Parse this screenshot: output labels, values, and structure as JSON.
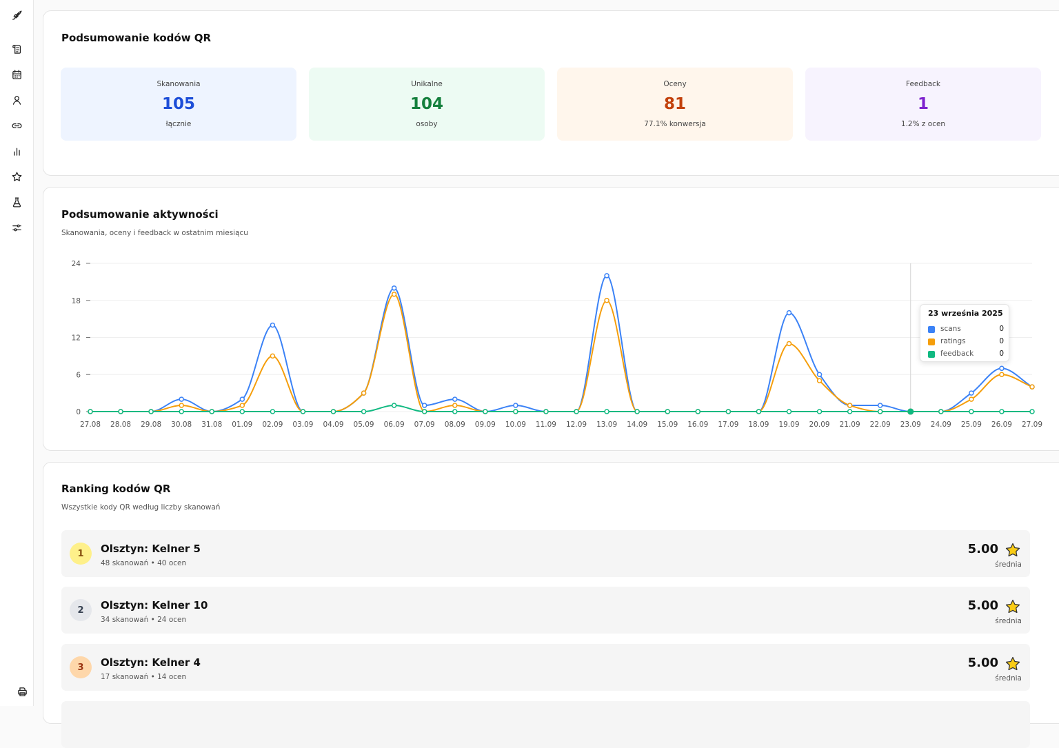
{
  "sidebar": {
    "icons": [
      "rocket-icon",
      "receipt-icon",
      "calendar-icon",
      "user-icon",
      "link-icon",
      "bar-chart-icon",
      "star-icon",
      "flask-icon",
      "settings-sliders-icon",
      "printer-icon"
    ]
  },
  "summary": {
    "title": "Podsumowanie kodów QR",
    "stats": [
      {
        "label": "Skanowania",
        "value": "105",
        "sub": "łącznie",
        "color": "#1d4ed8",
        "bg": "#eef4ff"
      },
      {
        "label": "Unikalne",
        "value": "104",
        "sub": "osoby",
        "color": "#15803d",
        "bg": "#edfbf3"
      },
      {
        "label": "Oceny",
        "value": "81",
        "sub": "77.1% konwersja",
        "color": "#c2410c",
        "bg": "#fff6ec"
      },
      {
        "label": "Feedback",
        "value": "1",
        "sub": "1.2% z ocen",
        "color": "#7e22ce",
        "bg": "#f7f3fe"
      }
    ]
  },
  "activity": {
    "title": "Podsumowanie aktywności",
    "subtitle": "Skanowania, oceny i feedback w ostatnim miesiącu",
    "tooltip": {
      "title": "23 września 2025",
      "rows": [
        {
          "name": "scans",
          "value": "0",
          "color": "#3b82f6"
        },
        {
          "name": "ratings",
          "value": "0",
          "color": "#f59e0b"
        },
        {
          "name": "feedback",
          "value": "0",
          "color": "#10b981"
        }
      ]
    }
  },
  "chart_data": {
    "type": "line",
    "title": "",
    "xlabel": "",
    "ylabel": "",
    "ylim": [
      0,
      24
    ],
    "yticks": [
      0,
      6,
      12,
      18,
      24
    ],
    "grid": true,
    "x": [
      "27.08",
      "28.08",
      "29.08",
      "30.08",
      "31.08",
      "01.09",
      "02.09",
      "03.09",
      "04.09",
      "05.09",
      "06.09",
      "07.09",
      "08.09",
      "09.09",
      "10.09",
      "11.09",
      "12.09",
      "13.09",
      "14.09",
      "15.09",
      "16.09",
      "17.09",
      "18.09",
      "19.09",
      "20.09",
      "21.09",
      "22.09",
      "23.09",
      "24.09",
      "25.09",
      "26.09",
      "27.09"
    ],
    "series": [
      {
        "name": "scans",
        "color": "#3b82f6",
        "values": [
          0,
          0,
          0,
          2,
          0,
          2,
          14,
          0,
          0,
          3,
          20,
          1,
          2,
          0,
          1,
          0,
          0,
          22,
          0,
          0,
          0,
          0,
          0,
          16,
          6,
          1,
          1,
          0,
          0,
          3,
          7,
          4
        ]
      },
      {
        "name": "ratings",
        "color": "#f59e0b",
        "values": [
          0,
          0,
          0,
          1,
          0,
          1,
          9,
          0,
          0,
          3,
          19,
          0,
          1,
          0,
          0,
          0,
          0,
          18,
          0,
          0,
          0,
          0,
          0,
          11,
          5,
          1,
          0,
          0,
          0,
          2,
          6,
          4
        ]
      },
      {
        "name": "feedback",
        "color": "#10b981",
        "values": [
          0,
          0,
          0,
          0,
          0,
          0,
          0,
          0,
          0,
          0,
          1,
          0,
          0,
          0,
          0,
          0,
          0,
          0,
          0,
          0,
          0,
          0,
          0,
          0,
          0,
          0,
          0,
          0,
          0,
          0,
          0,
          0
        ]
      }
    ],
    "highlight": "23.09"
  },
  "ranking": {
    "title": "Ranking kodów QR",
    "subtitle": "Wszystkie kody QR według liczby skanowań",
    "items": [
      {
        "rank": "1",
        "name": "Olsztyn: Kelner 5",
        "meta": "48 skanowań • 40 ocen",
        "score": "5.00",
        "avg": "średnia",
        "badge_bg": "#fef08a",
        "badge_fg": "#854d0e"
      },
      {
        "rank": "2",
        "name": "Olsztyn: Kelner 10",
        "meta": "34 skanowań • 24 ocen",
        "score": "5.00",
        "avg": "średnia",
        "badge_bg": "#e5e7eb",
        "badge_fg": "#374151"
      },
      {
        "rank": "3",
        "name": "Olsztyn: Kelner 4",
        "meta": "17 skanowań • 14 ocen",
        "score": "5.00",
        "avg": "średnia",
        "badge_bg": "#fed7aa",
        "badge_fg": "#9a3412"
      }
    ]
  }
}
